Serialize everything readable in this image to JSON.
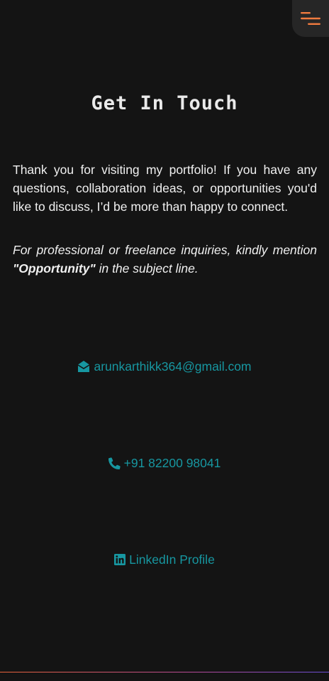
{
  "nav": {
    "menu_icon": "menu-lines-icon",
    "accent_color": "#f07b3f"
  },
  "page": {
    "title": "Get In Touch"
  },
  "intro": {
    "text": "Thank you for visiting my portfolio! If you have any questions, collaboration ideas, or opportunities you'd like to discuss, I’d be more than happy to connect."
  },
  "note": {
    "prefix": "For professional or freelance inquiries, kindly mention ",
    "keyword": "\"Opportunity\"",
    "suffix": " in the subject line."
  },
  "contacts": {
    "color": "#1797a1",
    "email": {
      "icon": "envelope-open-icon",
      "label": "arunkarthikk364@gmail.com"
    },
    "phone": {
      "icon": "phone-icon",
      "label": "+91 82200 98041"
    },
    "linkedin": {
      "icon": "linkedin-icon",
      "label": "LinkedIn Profile"
    }
  }
}
